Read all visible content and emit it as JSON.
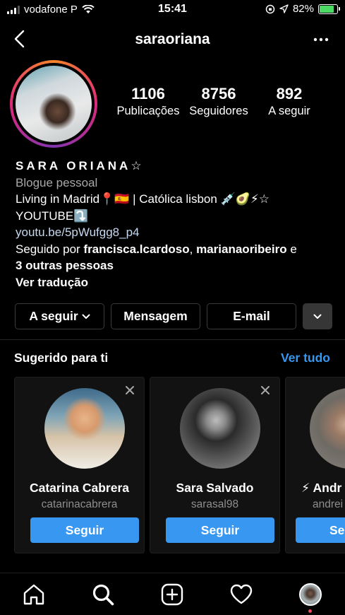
{
  "status_bar": {
    "carrier": "vodafone P",
    "time": "15:41",
    "battery_percent": "82%",
    "battery_level": 0.82
  },
  "header": {
    "username": "saraoriana"
  },
  "stats": [
    {
      "value": "1106",
      "label": "Publicações"
    },
    {
      "value": "8756",
      "label": "Seguidores"
    },
    {
      "value": "892",
      "label": "A seguir"
    }
  ],
  "bio": {
    "name": "SARA ORIANA☆",
    "category": "Blogue pessoal",
    "line1": "Living in Madrid📍🇪🇸 | Católica lisbon 💉🥑⚡☆",
    "line2": "YOUTUBE⤵️",
    "link": "youtu.be/5pWufgg8_p4",
    "followed_prefix": "Seguido por ",
    "followed_user1": "francisca.lcardoso",
    "followed_sep": ", ",
    "followed_user2": "marianaoribeiro",
    "followed_and": " e",
    "followed_others": "3 outras pessoas",
    "translate": "Ver tradução"
  },
  "actions": {
    "follow": "A seguir",
    "message": "Mensagem",
    "email": "E-mail"
  },
  "suggested": {
    "title": "Sugerido para ti",
    "see_all": "Ver tudo",
    "follow_label": "Seguir",
    "cards": [
      {
        "name": "Catarina Cabrera",
        "username": "catarinacabrera"
      },
      {
        "name": "Sara Salvado",
        "username": "sarasal98"
      },
      {
        "name": "⚡ Andr",
        "username": "andrei"
      }
    ]
  },
  "icons": {
    "back": "back-chevron-icon",
    "more": "more-horizontal-icon",
    "home": "home-icon",
    "search": "search-icon",
    "create": "plus-square-icon",
    "activity": "heart-icon",
    "profile": "profile-avatar-icon"
  },
  "colors": {
    "accent": "#3897f0",
    "battery": "#4cd964",
    "notification_dot": "#ed4956"
  }
}
